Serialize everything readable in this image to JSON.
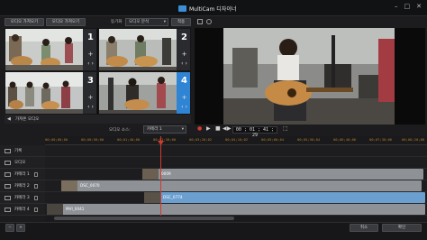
{
  "window": {
    "title": "MultiCam 디자이너",
    "controls": [
      "–",
      "□",
      "✕"
    ]
  },
  "toolbar": {
    "import_button": "오디오 가져오기",
    "import_audio_button": "오디오 가져오기",
    "sync_label": "동기화",
    "sync_option": "오디오 분석",
    "sync_button": "적용"
  },
  "cameras": [
    {
      "num": "1",
      "plus": "+",
      "arrows": "‹  ›"
    },
    {
      "num": "2",
      "plus": "+",
      "arrows": "‹  ›"
    },
    {
      "num": "3",
      "plus": "+",
      "arrows": "‹  ›"
    },
    {
      "num": "4",
      "plus": "+",
      "arrows": "‹  ›"
    }
  ],
  "audio_row": {
    "label": "가져온 오디오"
  },
  "source_row": {
    "label": "오디오 소스:",
    "value": "카메라 1"
  },
  "preview": {
    "timecode": "00 ; 01 ; 41 ; 29"
  },
  "ruler": {
    "ticks": [
      "00;00;00;00",
      "00;00;50;00",
      "00;01;40;00",
      "00;02;30;00",
      "00;03;20;02",
      "00;04;10;02",
      "00;05;00;04",
      "00;05;50;04",
      "00;06;40;06",
      "00;07;30;06",
      "00;08;20;08"
    ]
  },
  "tracks": [
    {
      "label": "기록"
    },
    {
      "label": "오디오"
    },
    {
      "label": "카메라 1"
    },
    {
      "label": "카메라 2"
    },
    {
      "label": "카메라 3"
    },
    {
      "label": "카메라 4"
    }
  ],
  "clips": [
    {
      "label": "0009"
    },
    {
      "label": "DSC_0070"
    },
    {
      "label": "DSC_0774"
    },
    {
      "label": "MVI_0041"
    }
  ],
  "bottom": {
    "ok_button": "확인",
    "cancel_button": "취소"
  },
  "colors": {
    "accent": "#2f84d3",
    "playhead": "#d23a30",
    "clip_gray": "#8e9296",
    "clip_blue": "#6b9fd0"
  }
}
